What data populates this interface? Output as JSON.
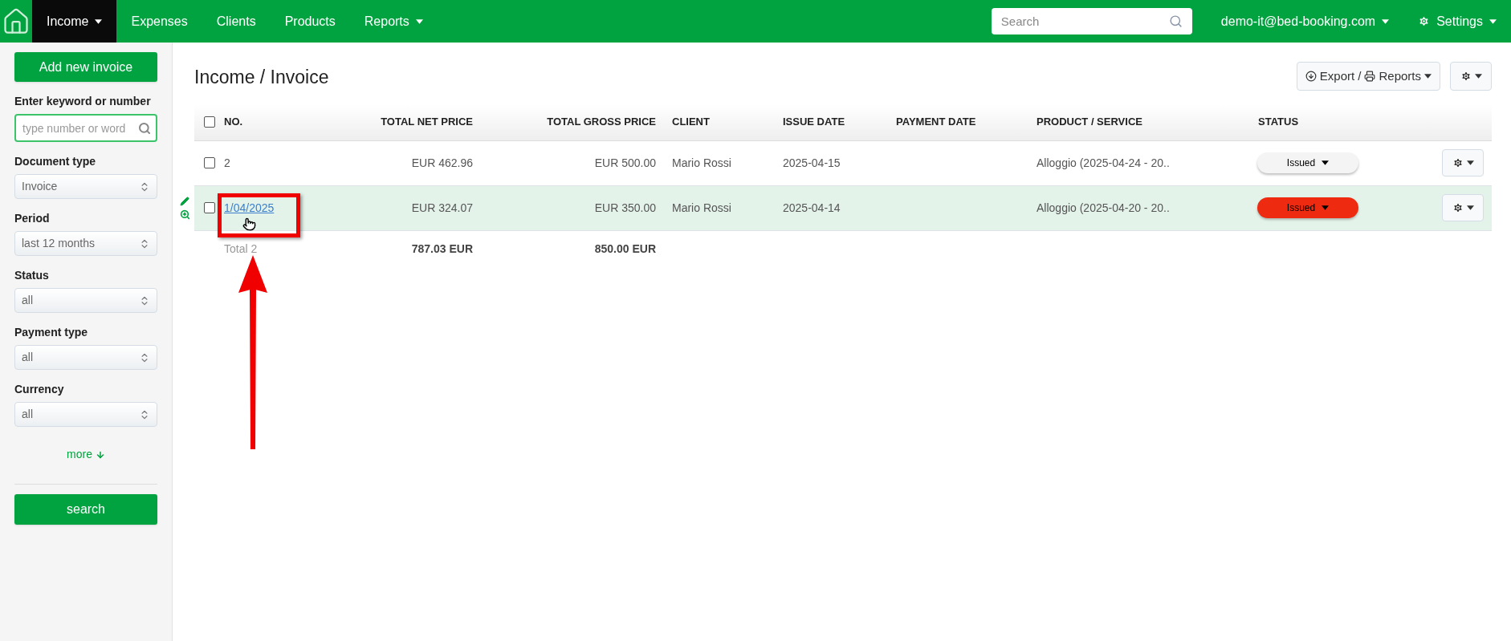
{
  "nav": {
    "items": [
      {
        "label": "Income",
        "selected": true,
        "dropdown": true
      },
      {
        "label": "Expenses",
        "selected": false,
        "dropdown": false
      },
      {
        "label": "Clients",
        "selected": false,
        "dropdown": false
      },
      {
        "label": "Products",
        "selected": false,
        "dropdown": false
      },
      {
        "label": "Reports",
        "selected": false,
        "dropdown": true
      }
    ],
    "search": {
      "placeholder": "Search"
    },
    "user": "demo-it@bed-booking.com",
    "settings": "Settings"
  },
  "sidebar": {
    "add_button": "Add new invoice",
    "filters": [
      {
        "kind": "search",
        "label": "Enter keyword or number",
        "placeholder": "type number or word"
      },
      {
        "kind": "select",
        "label": "Document type",
        "value": "Invoice"
      },
      {
        "kind": "select",
        "label": "Period",
        "value": "last 12 months"
      },
      {
        "kind": "select",
        "label": "Status",
        "value": "all"
      },
      {
        "kind": "select",
        "label": "Payment type",
        "value": "all"
      },
      {
        "kind": "select",
        "label": "Currency",
        "value": "all"
      }
    ],
    "more": "more",
    "search_button": "search"
  },
  "page": {
    "title": "Income / Invoice",
    "export_button": "Export / ",
    "reports_label": "Reports"
  },
  "table": {
    "all_checked": false,
    "columns": [
      "NO.",
      "TOTAL NET PRICE",
      "TOTAL GROSS PRICE",
      "CLIENT",
      "ISSUE DATE",
      "PAYMENT DATE",
      "PRODUCT / SERVICE",
      "STATUS"
    ],
    "rows": [
      {
        "no": "2",
        "link": false,
        "highlighted": false,
        "checked": false,
        "net": "EUR 462.96",
        "gross": "EUR 500.00",
        "client": "Mario Rossi",
        "issue_date": "2025-04-15",
        "product": "Alloggio (2025-04-24 - 20..",
        "status": "Issued",
        "color": "#f4f4f4"
      },
      {
        "no": "1/04/2025",
        "link": true,
        "highlighted": true,
        "checked": false,
        "net": "EUR 324.07",
        "gross": "EUR 350.00",
        "client": "Mario Rossi",
        "issue_date": "2025-04-14",
        "product": "Alloggio (2025-04-20 - 20..",
        "status": "Issued",
        "color": "#ee2a10"
      }
    ],
    "total": {
      "label": "Total 2",
      "net": "787.03 EUR",
      "gross": "850.00 EUR"
    }
  }
}
